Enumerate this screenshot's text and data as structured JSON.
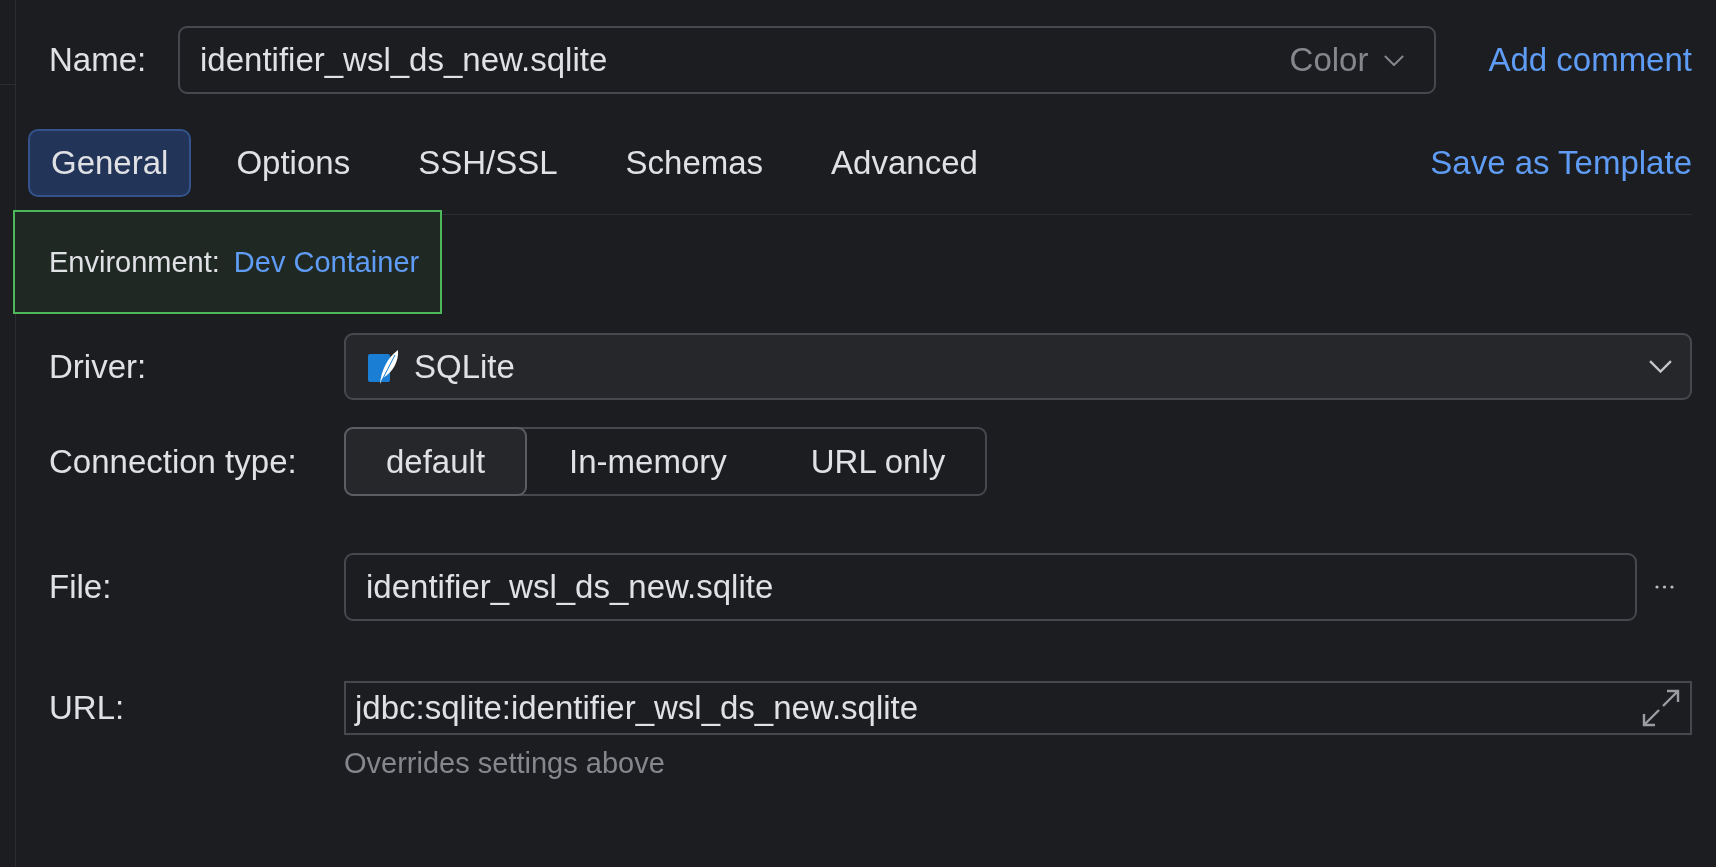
{
  "name_row": {
    "label": "Name:",
    "value": "identifier_wsl_ds_new.sqlite",
    "color_picker": "Color",
    "link": "Add comment"
  },
  "tabs": [
    {
      "label": "General",
      "selected": true
    },
    {
      "label": "Options",
      "selected": false
    },
    {
      "label": "SSH/SSL",
      "selected": false
    },
    {
      "label": "Schemas",
      "selected": false
    },
    {
      "label": "Advanced",
      "selected": false
    }
  ],
  "template_link": "Save as Template",
  "environment": {
    "label": "Environment:",
    "value": "Dev Container",
    "highlighted": true
  },
  "fields": [
    {
      "kind": "dropdown",
      "label": "Driver:",
      "value": "SQLite"
    },
    {
      "kind": "segmented",
      "label": "Connection type:",
      "options": [
        {
          "label": "default",
          "selected": true
        },
        {
          "label": "In-memory",
          "selected": false
        },
        {
          "label": "URL only",
          "selected": false
        }
      ]
    },
    {
      "kind": "file",
      "label": "File:",
      "value": "identifier_wsl_ds_new.sqlite"
    },
    {
      "kind": "url",
      "label": "URL:",
      "value": "jdbc:sqlite:identifier_wsl_ds_new.sqlite",
      "help_text": "Overrides settings above"
    }
  ]
}
